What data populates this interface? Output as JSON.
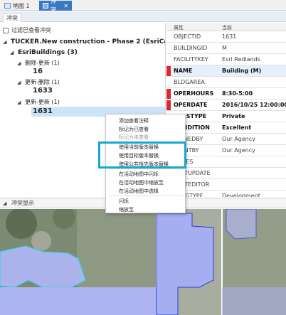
{
  "tabs": {
    "map_label": "地图 1",
    "conflict_label": "冲突",
    "close_glyph": "✕"
  },
  "subtab": {
    "label": "冲突"
  },
  "filter": {
    "label": "过滤已查看冲突"
  },
  "tree": {
    "root": "TUCKER.New construction - Phase 2 (EsriCampus) (3)",
    "layer": "EsriBuildings (3)",
    "groups": [
      {
        "label": "删除-更新 (1)",
        "oid": "16"
      },
      {
        "label": "更新-删除 (1)",
        "oid": "1633"
      },
      {
        "label": "更新-更新 (1)",
        "oid": "1631"
      }
    ]
  },
  "grid": {
    "header_attr": "属性",
    "header_current": "当前",
    "rows": [
      {
        "name": "OBJECTID",
        "value": "1631",
        "marker": "",
        "bold": false
      },
      {
        "name": "BUILDINGID",
        "value": "M",
        "marker": "",
        "bold": false
      },
      {
        "name": "FACILITYKEY",
        "value": "Esri Redlands",
        "marker": "",
        "bold": false
      },
      {
        "name": "NAME",
        "value": "Building (M)",
        "marker": "#d9282f",
        "bold": true
      },
      {
        "name": "BLDGAREA",
        "value": "",
        "marker": "",
        "bold": false
      },
      {
        "name": "OPERHOURS",
        "value": "8:30-5:00",
        "marker": "#d9282f",
        "bold": true
      },
      {
        "name": "OPERDATE",
        "value": "2016/10/25 12:00:00",
        "marker": "#d9282f",
        "bold": true
      },
      {
        "name": "USESTYPE",
        "value": "Private",
        "marker": "",
        "bold": true
      },
      {
        "name": "CONDITION",
        "value": "Excellent",
        "marker": "",
        "bold": true
      },
      {
        "name": "OWNEDBY",
        "value": "Our Agency",
        "marker": "",
        "bold": false
      },
      {
        "name": "MAINTBY",
        "value": "Our Agency",
        "marker": "",
        "bold": false
      },
      {
        "name": "NOTES",
        "value": "",
        "marker": "",
        "bold": false
      },
      {
        "name": "LASTUPDATE",
        "value": "",
        "marker": "",
        "bold": false
      },
      {
        "name": "LASTEDITOR",
        "value": "",
        "marker": "",
        "bold": false
      },
      {
        "name": "BLDGTYPE",
        "value": "Development",
        "marker": "",
        "bold": false
      }
    ]
  },
  "lower": {
    "title": "冲突显示"
  },
  "context_menu": {
    "items": [
      {
        "label": "添加查看注释",
        "disabled": false
      },
      {
        "label": "标记为已查看",
        "disabled": false
      },
      {
        "label": "标记为未查看",
        "disabled": true
      },
      {
        "label": "使用当前版本替换",
        "disabled": false
      },
      {
        "label": "使用目标版本替换",
        "disabled": false
      },
      {
        "label": "使用公共祖先版本替换",
        "disabled": false
      },
      {
        "label": "在活动地图中闪烁",
        "disabled": false
      },
      {
        "label": "在活动地图中缩放至",
        "disabled": false
      },
      {
        "label": "在活动地图中选择",
        "disabled": false
      },
      {
        "label": "闪烁",
        "disabled": false
      },
      {
        "label": "缩放至",
        "disabled": false
      }
    ]
  },
  "colors": {
    "accent": "#3a78c2",
    "conflict_marker": "#d9282f",
    "highlight_border": "#17a9d1",
    "building_fill": "#aeb4f2"
  }
}
